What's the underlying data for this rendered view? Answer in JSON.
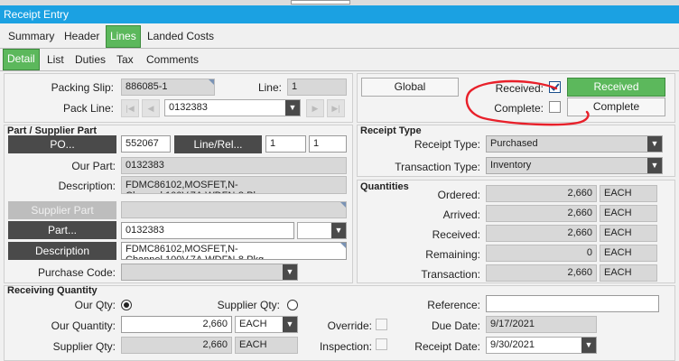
{
  "window": {
    "title": "Receipt Entry"
  },
  "tabs_main": [
    "Summary",
    "Header",
    "Lines",
    "Landed Costs"
  ],
  "tabs_sub": [
    "Detail",
    "List",
    "Duties",
    "Tax",
    "Comments"
  ],
  "header": {
    "packing_slip_label": "Packing Slip:",
    "packing_slip": "886085-1",
    "line_label": "Line:",
    "line": "1",
    "pack_line_label": "Pack Line:",
    "pack_line": "0132383"
  },
  "actions": {
    "global": "Global",
    "received_label": "Received:",
    "received_button": "Received",
    "complete_label": "Complete:",
    "complete_button": "Complete"
  },
  "part_section": {
    "title": "Part / Supplier Part",
    "po_button": "PO...",
    "po": "552067",
    "line_rel_button": "Line/Rel...",
    "line": "1",
    "rel": "1",
    "our_part_label": "Our Part:",
    "our_part": "0132383",
    "description_label": "Description:",
    "description": "FDMC86102,MOSFET,N-Channel,100V,7A,WDFN-8 Pkg",
    "supplier_part_button": "Supplier Part",
    "part_button": "Part...",
    "part": "0132383",
    "description_button": "Description",
    "description2": "FDMC86102,MOSFET,N-Channel,100V,7A,WDFN-8 Pkg",
    "purchase_code_label": "Purchase Code:"
  },
  "receipt_type": {
    "title": "Receipt Type",
    "receipt_type_label": "Receipt Type:",
    "receipt_type": "Purchased",
    "transaction_type_label": "Transaction Type:",
    "transaction_type": "Inventory"
  },
  "quantities": {
    "title": "Quantities",
    "rows": [
      {
        "label": "Ordered:",
        "value": "2,660",
        "uom": "EACH"
      },
      {
        "label": "Arrived:",
        "value": "2,660",
        "uom": "EACH"
      },
      {
        "label": "Received:",
        "value": "2,660",
        "uom": "EACH"
      },
      {
        "label": "Remaining:",
        "value": "0",
        "uom": "EACH"
      },
      {
        "label": "Transaction:",
        "value": "2,660",
        "uom": "EACH"
      }
    ]
  },
  "receiving": {
    "title": "Receiving Quantity",
    "our_qty_label": "Our Qty:",
    "supplier_qty_label": "Supplier Qty:",
    "our_quantity_label": "Our Quantity:",
    "our_quantity": "2,660",
    "our_uom": "EACH",
    "supplier_qty2_label": "Supplier Qty:",
    "supplier_qty": "2,660",
    "supplier_uom": "EACH",
    "override_label": "Override:",
    "inspection_label": "Inspection:",
    "reference_label": "Reference:",
    "reference": "",
    "due_date_label": "Due Date:",
    "due_date": "9/17/2021",
    "receipt_date_label": "Receipt Date:",
    "receipt_date": "9/30/2021"
  },
  "colors": {
    "title_bar": "#1ba1e2",
    "accent_green": "#5cb85c",
    "annotation_red": "#e8202a"
  }
}
